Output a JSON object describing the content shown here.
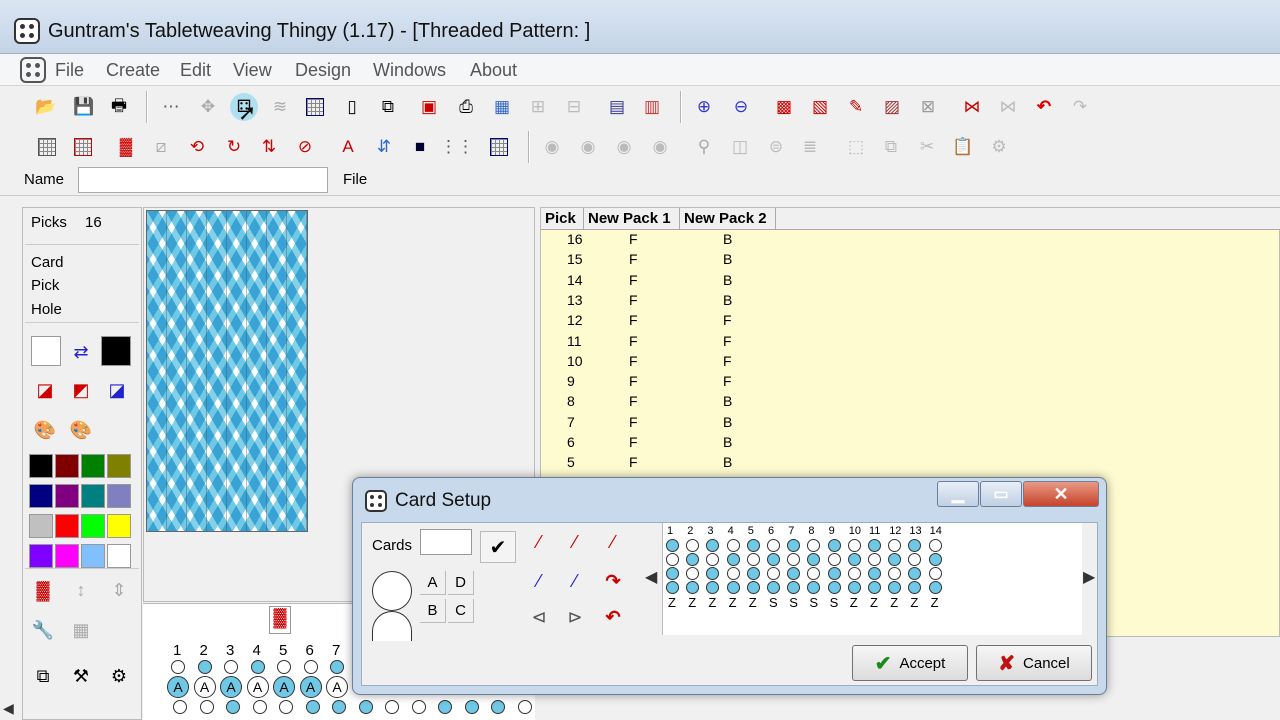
{
  "window": {
    "title": "Guntram's Tabletweaving Thingy (1.17) - [Threaded Pattern: ]"
  },
  "menu": [
    "File",
    "Create",
    "Edit",
    "View",
    "Design",
    "Windows",
    "About"
  ],
  "namebar": {
    "name_label": "Name",
    "name_value": "",
    "file_label": "File"
  },
  "left_panel": {
    "picks_label": "Picks",
    "picks_value": "16",
    "card_label": "Card",
    "pick_label": "Pick",
    "hole_label": "Hole"
  },
  "palette": [
    "#ffffff",
    "#000000",
    "#000000",
    "#800000",
    "#008000",
    "#808000",
    "#000080",
    "#800080",
    "#008080",
    "#8080c0",
    "#c0c0c0",
    "#ff0000",
    "#00ff00",
    "#ffff00",
    "#8000ff",
    "#ff00ff",
    "#80c0ff",
    "#ffffff"
  ],
  "threading": {
    "numbers": [
      "1",
      "2",
      "3",
      "4",
      "5",
      "6",
      "7"
    ],
    "letter": "A"
  },
  "table": {
    "headers": [
      "Pick",
      "New Pack 1",
      "New Pack 2"
    ],
    "rows": [
      [
        "16",
        "F",
        "B"
      ],
      [
        "15",
        "F",
        "B"
      ],
      [
        "14",
        "F",
        "B"
      ],
      [
        "13",
        "F",
        "B"
      ],
      [
        "12",
        "F",
        "F"
      ],
      [
        "11",
        "F",
        "F"
      ],
      [
        "10",
        "F",
        "F"
      ],
      [
        "9",
        "F",
        "F"
      ],
      [
        "8",
        "F",
        "B"
      ],
      [
        "7",
        "F",
        "B"
      ],
      [
        "6",
        "F",
        "B"
      ],
      [
        "5",
        "F",
        "B"
      ]
    ]
  },
  "dialog": {
    "title": "Card Setup",
    "cards_label": "Cards",
    "cards_value": "",
    "hole_labels": [
      "A",
      "D",
      "B",
      "C"
    ],
    "card_numbers": [
      "1",
      "2",
      "3",
      "4",
      "5",
      "6",
      "7",
      "8",
      "9",
      "10",
      "11",
      "12",
      "13",
      "14"
    ],
    "twists": [
      "Z",
      "Z",
      "Z",
      "Z",
      "Z",
      "S",
      "S",
      "S",
      "S",
      "Z",
      "Z",
      "Z",
      "Z",
      "Z"
    ],
    "accept_label": "Accept",
    "cancel_label": "Cancel"
  },
  "colors": {
    "accent_blue": "#6ec8e6",
    "table_bg": "#fffbd0",
    "dialog_frame": "#c9d9ec"
  }
}
